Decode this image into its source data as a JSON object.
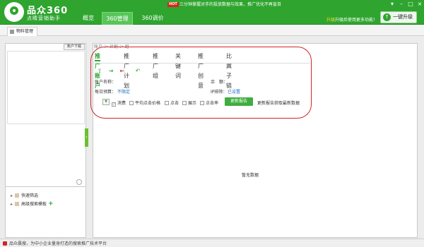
{
  "app": {
    "brand": "品众360",
    "subtitle": "点睛营销助手"
  },
  "nav": {
    "tabs": [
      {
        "label": "概览"
      },
      {
        "label": "360管理"
      },
      {
        "label": "360调价"
      }
    ],
    "active_index": 1
  },
  "notice": {
    "hot": "HOT",
    "text": "三分钟掌握对手的投放数据与效果，推广优化不再盲目"
  },
  "upgrade": {
    "tip_red": "升级",
    "tip_rest": "升级后使用更多功能！",
    "button": "一键升级"
  },
  "subtab": {
    "label": "物料管理"
  },
  "left": {
    "account_download": "账户下载",
    "tree": [
      {
        "label": "快速筛选"
      },
      {
        "label": "高级搜索模板"
      }
    ]
  },
  "breadcrumb": "账户 ＞ 计划 ＞ 组",
  "content_tabs": [
    {
      "label": "推广账户"
    },
    {
      "label": "推广计划"
    },
    {
      "label": "推广组"
    },
    {
      "label": "关键词"
    },
    {
      "label": "推广创意"
    },
    {
      "label": "比翼子链"
    }
  ],
  "toolbar_icons": [
    "upload-icon",
    "import-icon",
    "export-icon",
    "undo-icon"
  ],
  "fields": {
    "account_name_label": "账户名称：",
    "balance_label": "余　额：",
    "daily_budget_label": "每日预算：",
    "daily_budget_value": "不限定",
    "ip_exclude_label": "IP排除：",
    "ip_exclude_value": "已设置"
  },
  "report": {
    "checkboxes": [
      {
        "label": "消费",
        "checked": true
      },
      {
        "label": "平均点击价格",
        "checked": false
      },
      {
        "label": "点击",
        "checked": false
      },
      {
        "label": "展示",
        "checked": false
      },
      {
        "label": "点击率",
        "checked": false
      }
    ],
    "button": "更新报告",
    "hint": "更新报告获取最新数据"
  },
  "empty_text": "暂无数据",
  "status": {
    "text": "品众晨搜，为中小企业量身打造的搜索推广技术平台"
  },
  "colors": {
    "brand_green": "#2fa52f",
    "highlight_red": "#d0242a",
    "link_blue": "#1a6ec2"
  }
}
